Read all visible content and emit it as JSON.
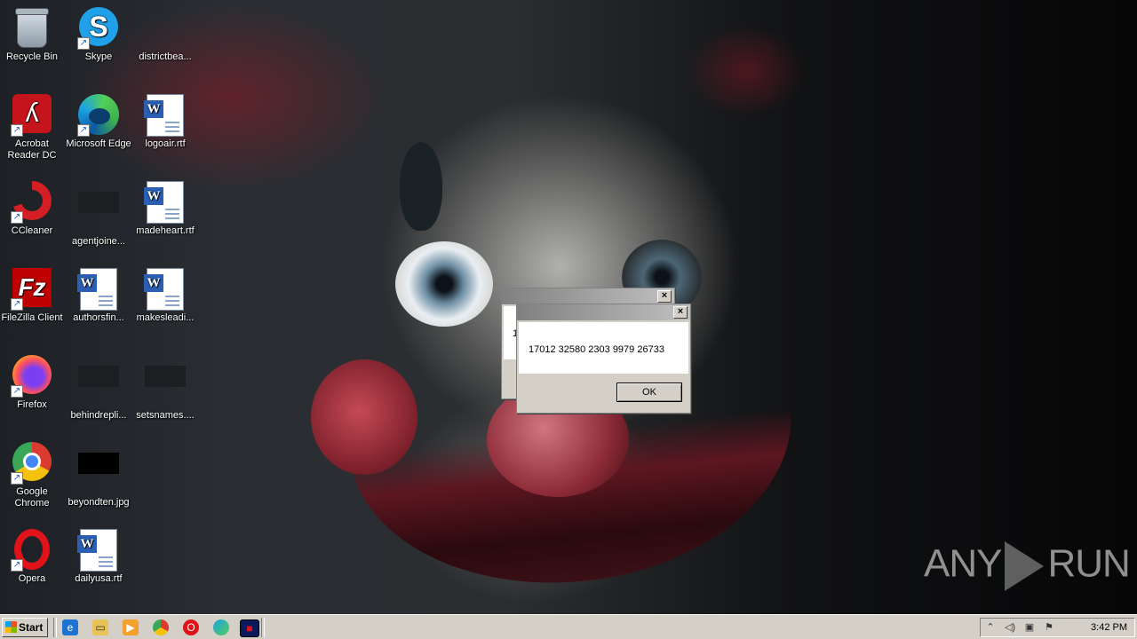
{
  "desktop_icons": [
    {
      "label": "Recycle Bin",
      "icon": "recycle-bin-icon"
    },
    {
      "label": "Skype",
      "icon": "skype-icon"
    },
    {
      "label": "districtbea...",
      "icon": "blank-file-icon"
    },
    {
      "label": "Acrobat Reader DC",
      "icon": "acrobat-icon"
    },
    {
      "label": "Microsoft Edge",
      "icon": "edge-icon"
    },
    {
      "label": "logoair.rtf",
      "icon": "word-doc-icon"
    },
    {
      "label": "CCleaner",
      "icon": "ccleaner-icon"
    },
    {
      "label": "agentjoine...",
      "icon": "blank-file-icon"
    },
    {
      "label": "madeheart.rtf",
      "icon": "word-doc-icon"
    },
    {
      "label": "FileZilla Client",
      "icon": "filezilla-icon"
    },
    {
      "label": "authorsfin...",
      "icon": "word-doc-icon"
    },
    {
      "label": "makesleadi...",
      "icon": "word-doc-icon"
    },
    {
      "label": "Firefox",
      "icon": "firefox-icon"
    },
    {
      "label": "behindrepli...",
      "icon": "image-file-icon"
    },
    {
      "label": "setsnames....",
      "icon": "image-file-icon"
    },
    {
      "label": "Google Chrome",
      "icon": "chrome-icon"
    },
    {
      "label": "beyondten.jpg",
      "icon": "jpg-thumbnail-icon"
    },
    {
      "label": "Opera",
      "icon": "opera-icon"
    },
    {
      "label": "dailyusa.rtf",
      "icon": "word-doc-icon"
    }
  ],
  "dialog_back": {
    "close_label": "×",
    "partial_text": "1"
  },
  "dialog_front": {
    "close_label": "×",
    "message": "17012 32580 2303 9979 26733",
    "ok_label": "OK"
  },
  "watermark": {
    "text_left": "ANY",
    "text_right": "RUN"
  },
  "taskbar": {
    "start_label": "Start",
    "quick_launch": [
      "ie-icon",
      "folder-icon",
      "media-player-icon",
      "chrome-icon",
      "opera-icon",
      "edge-icon",
      "app-window-icon"
    ],
    "clock": "3:42 PM",
    "tray_icons": [
      "chevron-up-icon",
      "volume-icon",
      "network-icon",
      "flag-icon"
    ]
  }
}
